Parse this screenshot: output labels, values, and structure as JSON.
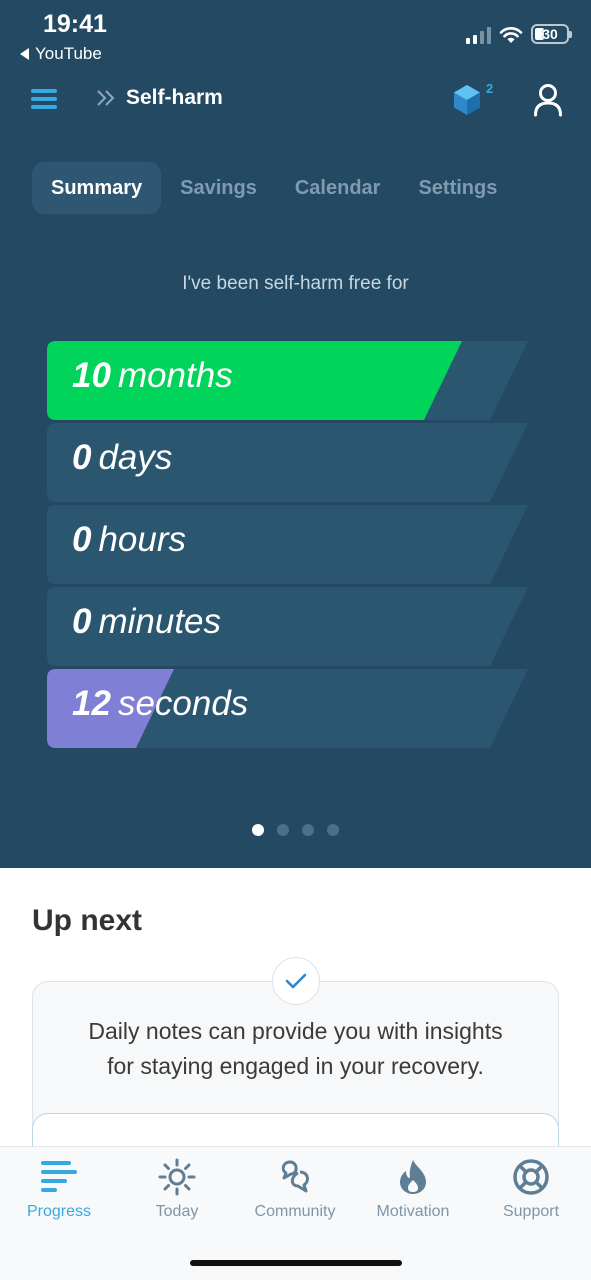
{
  "status_bar": {
    "time": "19:41",
    "back_app": "YouTube",
    "battery": "30"
  },
  "header": {
    "title": "Self-harm",
    "gem_count": "2"
  },
  "tabs": [
    {
      "label": "Summary",
      "active": true
    },
    {
      "label": "Savings",
      "active": false
    },
    {
      "label": "Calendar",
      "active": false
    },
    {
      "label": "Settings",
      "active": false
    }
  ],
  "subtitle": "I've been self-harm free for",
  "timer": [
    {
      "value": "10",
      "unit": "months",
      "progress": 0.85,
      "color": "#00d45a"
    },
    {
      "value": "0",
      "unit": "days",
      "progress": 0,
      "color": "#00d45a"
    },
    {
      "value": "0",
      "unit": "hours",
      "progress": 0,
      "color": "#00d45a"
    },
    {
      "value": "0",
      "unit": "minutes",
      "progress": 0,
      "color": "#00d45a"
    },
    {
      "value": "12",
      "unit": "seconds",
      "progress": 0.2,
      "color": "#7f7fd6"
    }
  ],
  "pager": {
    "count": 4,
    "active": 0
  },
  "up_next": {
    "title": "Up next",
    "card_text_line1": "Daily notes can provide you with insights",
    "card_text_line2": "for staying engaged in your recovery."
  },
  "nav": [
    {
      "label": "Progress",
      "icon": "progress-icon",
      "active": true
    },
    {
      "label": "Today",
      "icon": "sun-icon",
      "active": false
    },
    {
      "label": "Community",
      "icon": "community-icon",
      "active": false
    },
    {
      "label": "Motivation",
      "icon": "flame-icon",
      "active": false
    },
    {
      "label": "Support",
      "icon": "lifebuoy-icon",
      "active": false
    }
  ],
  "colors": {
    "header_bg": "#244a63",
    "accent": "#36a9e1",
    "bar_bg": "#2b5670"
  }
}
